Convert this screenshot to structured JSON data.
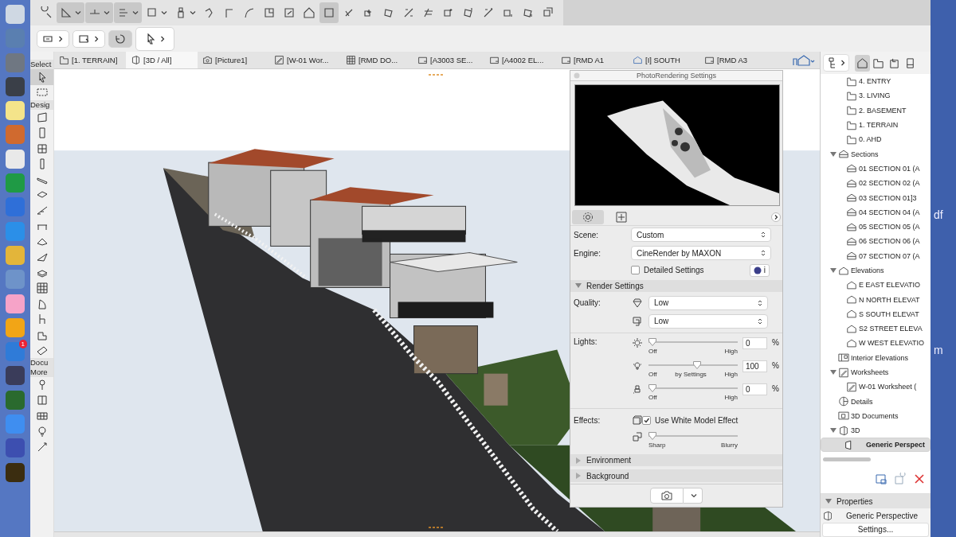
{
  "dock": {
    "badge": "1"
  },
  "toolbar": {
    "buttons": [
      {
        "on": false,
        "menu": false
      },
      {
        "on": true,
        "menu": true
      },
      {
        "on": true,
        "menu": true
      },
      {
        "on": true,
        "menu": true
      },
      {
        "on": false,
        "menu": true
      },
      {
        "on": false,
        "menu": true
      },
      {
        "on": false,
        "menu": false
      },
      {
        "on": false,
        "menu": false
      },
      {
        "on": false,
        "menu": false
      },
      {
        "on": false,
        "menu": false
      },
      {
        "on": false,
        "menu": false
      },
      {
        "on": false,
        "menu": false
      },
      {
        "on": true,
        "menu": false
      },
      {
        "on": false,
        "menu": false
      },
      {
        "on": false,
        "menu": false
      },
      {
        "on": false,
        "menu": false
      },
      {
        "on": false,
        "menu": false
      },
      {
        "on": false,
        "menu": false
      },
      {
        "on": false,
        "menu": false
      },
      {
        "on": false,
        "menu": false
      },
      {
        "on": false,
        "menu": false
      },
      {
        "on": false,
        "menu": false
      },
      {
        "on": false,
        "menu": false
      },
      {
        "on": false,
        "menu": false
      }
    ]
  },
  "nav_row": {
    "buttons": [
      {
        "on": false,
        "menu": true
      },
      {
        "on": false,
        "menu": true
      },
      {
        "on": true,
        "menu": false
      },
      {
        "on": false,
        "menu": true
      }
    ]
  },
  "toolbox": {
    "groups": [
      {
        "label": "Select",
        "tools": [
          {
            "selected": true
          },
          {
            "selected": false
          }
        ]
      },
      {
        "label": "Desig",
        "tools": [
          {
            "selected": false
          },
          {
            "selected": false
          },
          {
            "selected": false
          },
          {
            "selected": false
          },
          {
            "selected": false
          },
          {
            "selected": false
          },
          {
            "selected": false
          },
          {
            "selected": false
          },
          {
            "selected": false
          },
          {
            "selected": false
          },
          {
            "selected": false
          },
          {
            "selected": false
          },
          {
            "selected": false
          },
          {
            "selected": false
          },
          {
            "selected": false
          },
          {
            "selected": false
          }
        ]
      },
      {
        "label": "Docu"
      },
      {
        "label": "More",
        "tools": [
          {
            "selected": false
          },
          {
            "selected": false
          },
          {
            "selected": false
          },
          {
            "selected": false
          },
          {
            "selected": false
          }
        ]
      }
    ]
  },
  "tabs": [
    {
      "label": "[1. TERRAIN]",
      "kind": "story",
      "selected": false
    },
    {
      "label": "[3D / All]",
      "kind": "view3d",
      "selected": true
    },
    {
      "label": "[Picture1]",
      "kind": "picture",
      "selected": false
    },
    {
      "label": "[W-01 Wor...",
      "kind": "worksheet",
      "selected": false
    },
    {
      "label": "[RMD DO...",
      "kind": "schedule",
      "selected": false
    },
    {
      "label": "[A3003 SE...",
      "kind": "layout",
      "selected": false
    },
    {
      "label": "[A4002 EL...",
      "kind": "layout",
      "selected": false
    },
    {
      "label": "[RMD A1",
      "kind": "layout",
      "selected": false
    },
    {
      "label": "[I] SOUTH",
      "kind": "elevation",
      "selected": false
    },
    {
      "label": "[RMD A3",
      "kind": "layout",
      "selected": false
    }
  ],
  "photorendering": {
    "title": "PhotoRendering Settings",
    "tabs": [
      {
        "kind": "settings",
        "selected": true
      },
      {
        "kind": "size",
        "selected": false
      }
    ],
    "scene_label": "Scene:",
    "scene": "Custom",
    "engine_label": "Engine:",
    "engine": "CineRender by MAXON",
    "detailed_settings": {
      "label": "Detailed Settings",
      "checked": false
    },
    "engine_info": "i",
    "sections": [
      {
        "title": "Render Settings",
        "expanded": true
      }
    ],
    "quality_label": "Quality:",
    "quality": [
      {
        "kind": "quality",
        "value": "Low"
      },
      {
        "kind": "preview",
        "value": "Low"
      }
    ],
    "lights_label": "Lights:",
    "lights": [
      {
        "kind": "sun",
        "level": 0,
        "value": "0",
        "unit": "%",
        "marks": [
          "Off",
          "High"
        ]
      },
      {
        "kind": "lamp",
        "level": 0.5,
        "value": "100",
        "unit": "%",
        "marks": [
          "Off",
          "by Settings",
          "High"
        ]
      },
      {
        "kind": "fog",
        "level": 0,
        "value": "0",
        "unit": "%",
        "marks": [
          "Off",
          "High"
        ]
      }
    ],
    "effects_label": "Effects:",
    "white_model": {
      "label": "Use White Model Effect",
      "checked": true
    },
    "blur": {
      "level": 0,
      "marks": [
        "Sharp",
        "Blurry"
      ]
    },
    "collapsed_sections": [
      {
        "title": "Environment",
        "expanded": false
      },
      {
        "title": "Background",
        "expanded": false
      }
    ]
  },
  "navigator": {
    "maps": [
      {
        "kind": "project",
        "selected": true
      },
      {
        "kind": "views",
        "selected": false
      },
      {
        "kind": "layouts",
        "selected": false
      },
      {
        "kind": "publisher",
        "selected": false
      }
    ],
    "stories": [
      {
        "label": "4. ENTRY",
        "kind": "story",
        "selected": false
      },
      {
        "label": "3. LIVING",
        "kind": "story",
        "selected": false
      },
      {
        "label": "2. BASEMENT",
        "kind": "story",
        "selected": false
      },
      {
        "label": "1. TERRAIN",
        "kind": "story",
        "selected": false
      },
      {
        "label": "0. AHD",
        "kind": "story",
        "selected": false
      }
    ],
    "tree": [
      {
        "label": "Sections",
        "kind": "section",
        "expanded": true,
        "selected": false,
        "children": [
          {
            "label": "01 SECTION 01 (A",
            "kind": "section",
            "selected": false
          },
          {
            "label": "02 SECTION 02 (A",
            "kind": "section",
            "selected": false
          },
          {
            "label": "03 SECTION 01]3",
            "kind": "section",
            "selected": false
          },
          {
            "label": "04 SECTION 04 (A",
            "kind": "section",
            "selected": false
          },
          {
            "label": "05 SECTION 05 (A",
            "kind": "section",
            "selected": false
          },
          {
            "label": "06 SECTION 06 (A",
            "kind": "section",
            "selected": false
          },
          {
            "label": "07 SECTION 07 (A",
            "kind": "section",
            "selected": false
          }
        ]
      },
      {
        "label": "Elevations",
        "kind": "elevation",
        "expanded": true,
        "selected": false,
        "children": [
          {
            "label": "E EAST ELEVATIO",
            "kind": "elevation",
            "selected": false
          },
          {
            "label": "N NORTH ELEVAT",
            "kind": "elevation",
            "selected": false
          },
          {
            "label": "S SOUTH ELEVAT",
            "kind": "elevation",
            "selected": false
          },
          {
            "label": "S2 STREET ELEVA",
            "kind": "elevation",
            "selected": false
          },
          {
            "label": "W WEST ELEVATIO",
            "kind": "elevation",
            "selected": false
          }
        ]
      },
      {
        "label": "Interior Elevations",
        "kind": "interior",
        "selected": false
      },
      {
        "label": "Worksheets",
        "kind": "worksheet",
        "expanded": true,
        "selected": false,
        "children": [
          {
            "label": "W-01 Worksheet (",
            "kind": "worksheet",
            "selected": false
          }
        ]
      },
      {
        "label": "Details",
        "kind": "detail",
        "selected": false
      },
      {
        "label": "3D Documents",
        "kind": "doc3d",
        "selected": false
      },
      {
        "label": "3D",
        "kind": "view3d",
        "expanded": true,
        "selected": false,
        "children": [
          {
            "label": "Generic Perspect",
            "kind": "perspective",
            "selected": true
          }
        ]
      }
    ]
  },
  "properties": {
    "title": "Properties",
    "expanded": true,
    "name": "Generic Perspective",
    "button": "Settings..."
  },
  "desktop": {
    "fragments": [
      "df",
      "m"
    ]
  }
}
